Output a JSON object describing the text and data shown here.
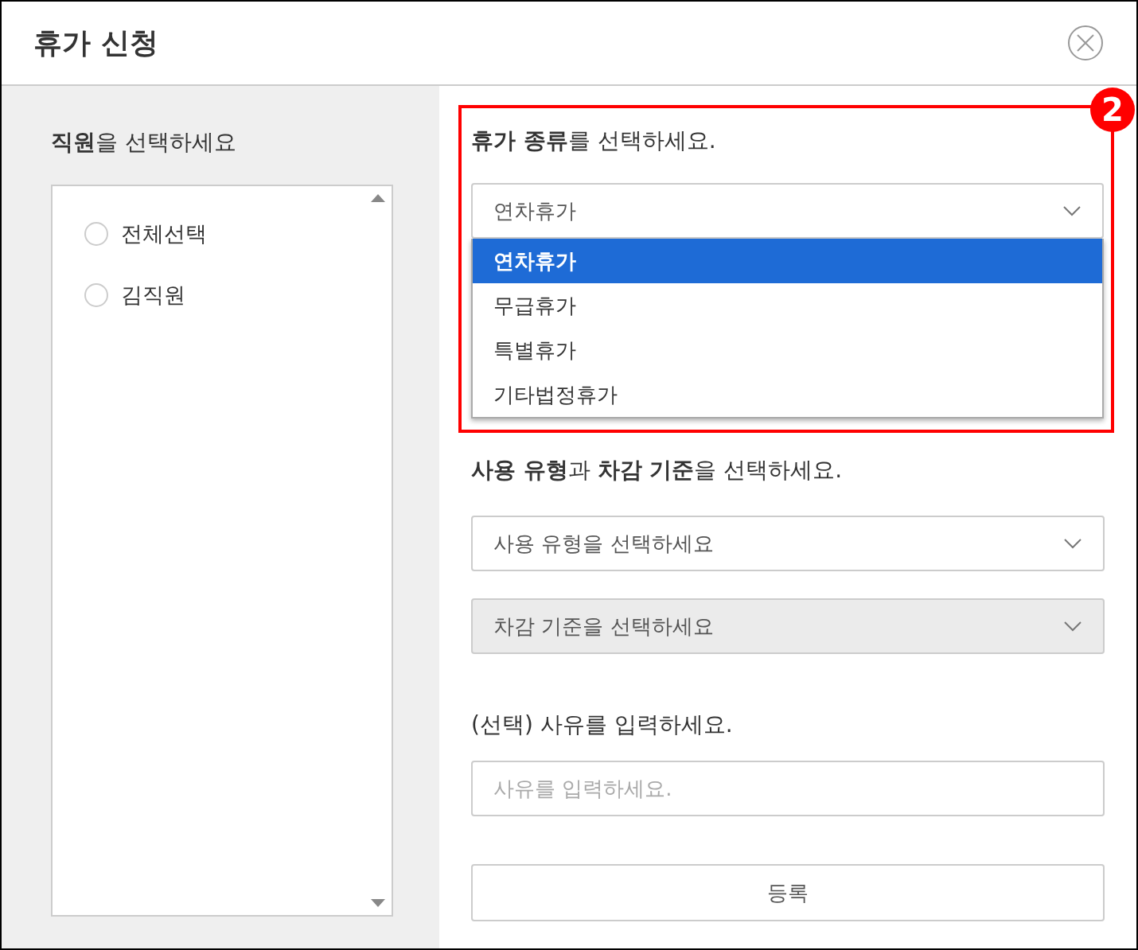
{
  "window": {
    "title": "휴가 신청"
  },
  "employee_panel": {
    "heading": "**직원**을 선택하세요",
    "items": [
      {
        "label": "전체선택",
        "selected": false
      },
      {
        "label": "김직원",
        "selected": false
      }
    ]
  },
  "leave_type": {
    "annotation": {
      "number": "2"
    },
    "heading": "**휴가 종류**를 선택하세요.",
    "value": "연차휴가",
    "expanded": true,
    "options": [
      {
        "label": "연차휴가",
        "selected": true
      },
      {
        "label": "무급휴가",
        "selected": false
      },
      {
        "label": "특별휴가",
        "selected": false
      },
      {
        "label": "기타법정휴가",
        "selected": false
      }
    ]
  },
  "usage": {
    "heading": "**사용 유형**과 **차감 기준**을 선택하세요.",
    "selects": [
      {
        "placeholder": "사용 유형을 선택하세요",
        "disabled": false
      },
      {
        "placeholder": "차감 기준을 선택하세요",
        "disabled": true
      }
    ]
  },
  "reason": {
    "heading": "(선택) 사유를 입력하세요.",
    "placeholder": "사유를 입력하세요."
  },
  "submit": {
    "label": "등록"
  }
}
